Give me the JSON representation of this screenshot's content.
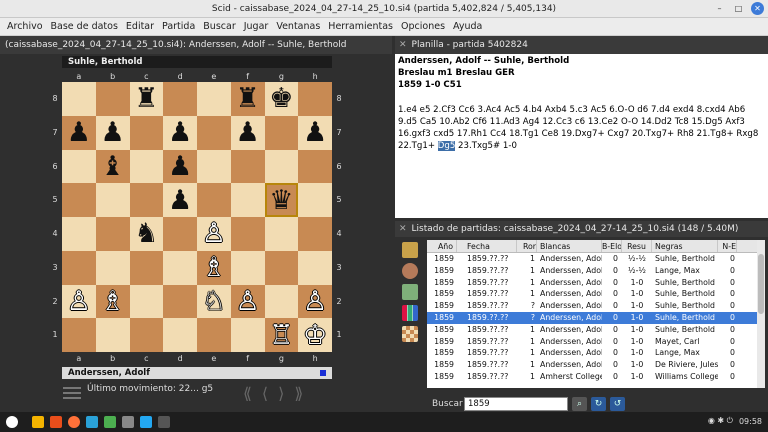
{
  "window": {
    "title": "Scid - caissabase_2024_04_27-14_25_10.si4 (partida 5,402,824 / 5,405,134)",
    "min": "–",
    "max": "□",
    "close": "✕"
  },
  "menu": [
    "Archivo",
    "Base de datos",
    "Editar",
    "Partida",
    "Buscar",
    "Jugar",
    "Ventanas",
    "Herramientas",
    "Opciones",
    "Ayuda"
  ],
  "board_panel": {
    "header": "(caissabase_2024_04_27-14_25_10.si4): Anderssen, Adolf -- Suhle, Berthold",
    "top_player": "Suhle, Berthold",
    "bottom_player": "Anderssen, Adolf",
    "files": [
      "a",
      "b",
      "c",
      "d",
      "e",
      "f",
      "g",
      "h"
    ],
    "ranks": [
      "8",
      "7",
      "6",
      "5",
      "4",
      "3",
      "2",
      "1"
    ],
    "position": [
      [
        "",
        "",
        "♜",
        "",
        "",
        "♜",
        "♚",
        ""
      ],
      [
        "♟",
        "♟",
        "",
        "♟",
        "",
        "♟",
        "",
        "♟"
      ],
      [
        "",
        "♝",
        "",
        "♟",
        "",
        "",
        "",
        ""
      ],
      [
        "",
        "",
        "",
        "♟",
        "",
        "",
        "♛",
        ""
      ],
      [
        "",
        "",
        "♞",
        "",
        "♙",
        "",
        "",
        ""
      ],
      [
        "",
        "",
        "",
        "",
        "♗",
        "",
        "",
        ""
      ],
      [
        "♙",
        "♗",
        "",
        "",
        "♘",
        "♙",
        "",
        "♙"
      ],
      [
        "",
        "",
        "",
        "",
        "",
        "",
        "♖",
        "♔"
      ]
    ],
    "selected_square": "g5",
    "last_move": "Último movimiento: 22... ",
    "last_move_sq": "g5",
    "nav": [
      "⟪",
      "⟨",
      "⟩",
      "⟫"
    ]
  },
  "planilla": {
    "header": "Planilla - partida 5402824",
    "line1": "Anderssen, Adolf   --   Suhle, Berthold",
    "line2": "Breslau m1  Breslau GER",
    "line3": "1859  1-0  C51",
    "moves_before": "1.e4 e5 2.Cf3 Cc6 3.Ac4 Ac5 4.b4 Axb4 5.c3 Ac5 6.O-O d6 7.d4 exd4 8.cxd4 Ab6 9.d5 Ca5 10.Ab2 Cf6 11.Ad3 Ag4 12.Cc3 c6 13.Ce2 O-O 14.Dd2 Tc8 15.Dg5 Axf3 16.gxf3 cxd5 17.Rh1 Cc4 18.Tg1 Ce8 19.Dxg7+ Cxg7 20.Txg7+ Rh8 21.Tg8+ Rxg8 22.Tg1+ ",
    "moves_current": "Dg5",
    "moves_after": " 23.Txg5# 1-0"
  },
  "game_list": {
    "header": "Listado de partidas: caissabase_2024_04_27-14_25_10.si4 (148 / 5.40M)",
    "columns": [
      "Año",
      "Fecha",
      "Ror",
      "Blancas",
      "B-Elo",
      "Resu",
      "Negras",
      "N-E"
    ],
    "rows": [
      [
        "1859",
        "1859.??.??",
        "1",
        "Anderssen, Adolf",
        "0",
        "½-½",
        "Suhle, Berthold",
        "0"
      ],
      [
        "1859",
        "1859.??.??",
        "1",
        "Anderssen, Adolf",
        "0",
        "½-½",
        "Lange, Max",
        "0"
      ],
      [
        "1859",
        "1859.??.??",
        "1",
        "Anderssen, Adolf",
        "0",
        "1-0",
        "Suhle, Berthold",
        "0"
      ],
      [
        "1859",
        "1859.??.??",
        "1",
        "Anderssen, Adolf",
        "0",
        "1-0",
        "Suhle, Berthold",
        "0"
      ],
      [
        "1859",
        "1859.??.??",
        "?",
        "Anderssen, Adolf",
        "0",
        "1-0",
        "Suhle, Berthold",
        "0"
      ],
      [
        "1859",
        "1859.??.??",
        "?",
        "Anderssen, Adolf",
        "0",
        "1-0",
        "Suhle, Berthold",
        "0"
      ],
      [
        "1859",
        "1859.??.??",
        "1",
        "Anderssen, Adolf",
        "0",
        "1-0",
        "Suhle, Berthold",
        "0"
      ],
      [
        "1859",
        "1859.??.??",
        "1",
        "Anderssen, Adolf",
        "0",
        "1-0",
        "Mayet, Carl",
        "0"
      ],
      [
        "1859",
        "1859.??.??",
        "1",
        "Anderssen, Adolf",
        "0",
        "1-0",
        "Lange, Max",
        "0"
      ],
      [
        "1859",
        "1859.??.??",
        "1",
        "Anderssen, Adolf",
        "0",
        "1-0",
        "De Riviere, Jules",
        "0"
      ],
      [
        "1859",
        "1859.??.??",
        "1",
        "Amherst College",
        "0",
        "1-0",
        "Williams College",
        "0"
      ]
    ],
    "selected_row": 5,
    "search_label": "Buscar",
    "search_value": "1859"
  },
  "taskbar": {
    "clock": "09:58"
  }
}
